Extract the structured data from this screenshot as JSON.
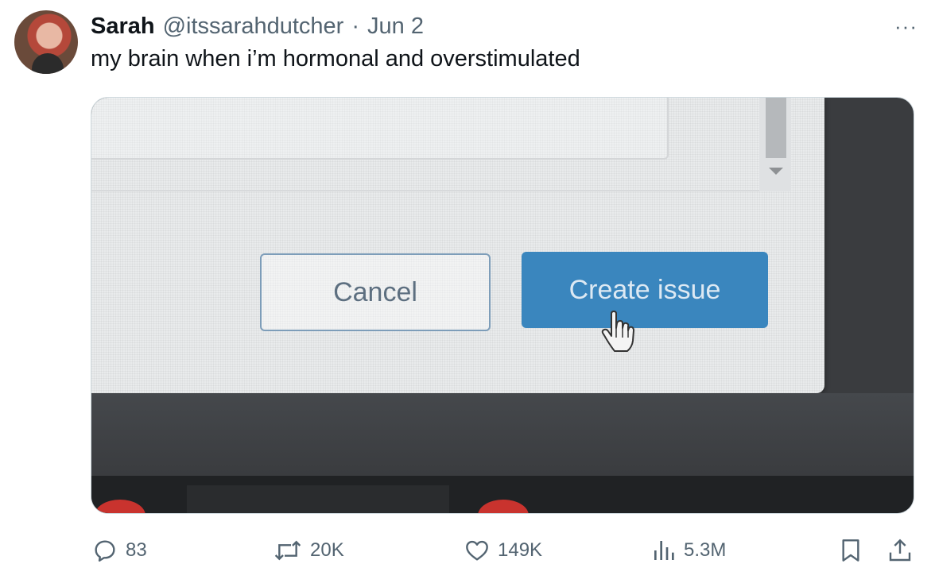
{
  "tweet": {
    "display_name": "Sarah",
    "handle": "@itssarahdutcher",
    "separator": "·",
    "date": "Jun 2",
    "more_label": "···",
    "text": "my brain when i’m hormonal and overstimulated"
  },
  "media": {
    "cancel_label": "Cancel",
    "create_label": "Create issue",
    "button_color": "#3a86be"
  },
  "actions": {
    "replies": "83",
    "reposts": "20K",
    "likes": "149K",
    "views": "5.3M"
  },
  "icons": {
    "reply": "speech-bubble-icon",
    "repost": "repost-arrows-icon",
    "like": "heart-icon",
    "views": "bar-chart-icon",
    "bookmark": "bookmark-icon",
    "share": "share-upload-icon",
    "cursor": "hand-pointer-icon"
  }
}
